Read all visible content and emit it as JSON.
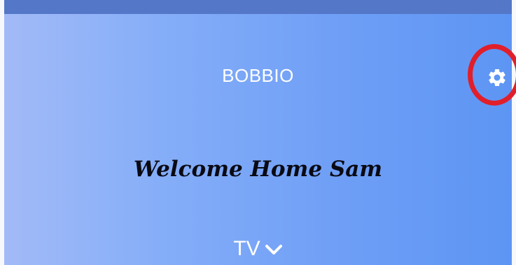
{
  "header": {
    "app_title": "BOBBIO",
    "settings_icon": "gear-icon"
  },
  "main": {
    "welcome_text": "Welcome Home Sam",
    "room_selector": {
      "value": "TV",
      "icon": "chevron-down-icon"
    }
  },
  "colors": {
    "top_bar": "#5477c8",
    "gradient_start": "#a2baf7",
    "gradient_end": "#5d95f4",
    "highlight_ring": "#e01f2a",
    "text_light": "#ffffff",
    "text_dark": "#0a0a14"
  }
}
